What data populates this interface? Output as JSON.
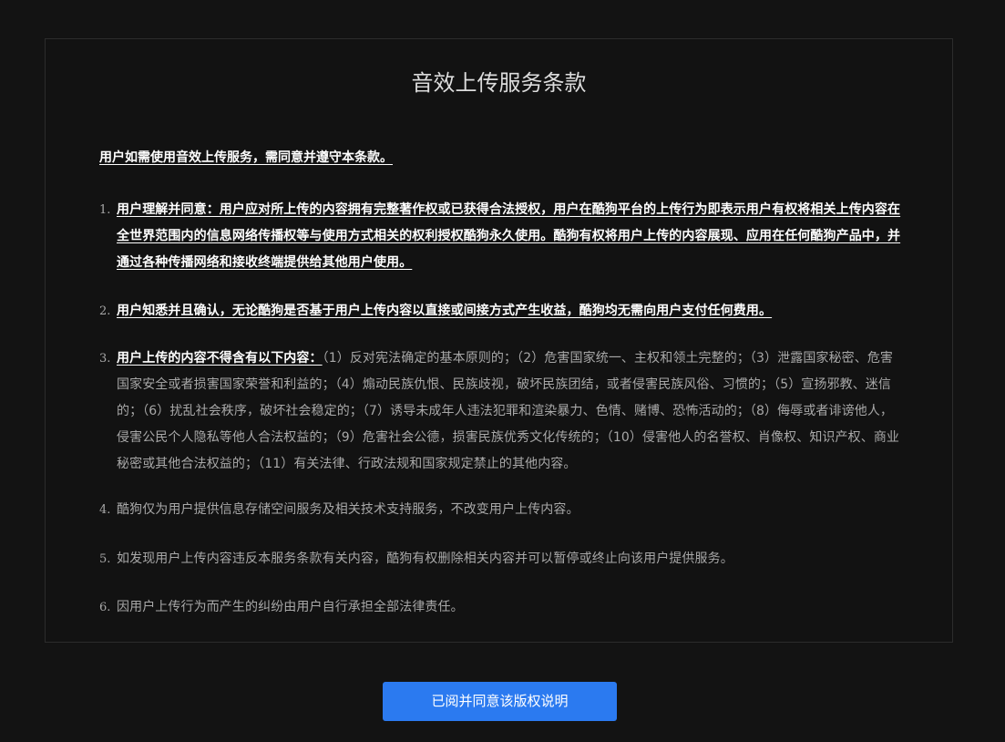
{
  "terms": {
    "title": "音效上传服务条款",
    "intro": "用户如需使用音效上传服务，需同意并遵守本条款。",
    "clauses": [
      {
        "number": "1.",
        "emphasis": "用户理解并同意：用户应对所上传的内容拥有完整著作权或已获得合法授权，用户在酷狗平台的上传行为即表示用户有权将相关上传内容在全世界范围内的信息网络传播权等与使用方式相关的权利授权酷狗永久使用。酷狗有权将用户上传的内容展现、应用在任何酷狗产品中，并通过各种传播网络和接收终端提供给其他用户使用。",
        "text": ""
      },
      {
        "number": "2.",
        "emphasis": "用户知悉并且确认，无论酷狗是否基于用户上传内容以直接或间接方式产生收益，酷狗均无需向用户支付任何费用。",
        "text": ""
      },
      {
        "number": "3.",
        "emphasis": "用户上传的内容不得含有以下内容：",
        "text": "（1）反对宪法确定的基本原则的；（2）危害国家统一、主权和领土完整的；（3）泄露国家秘密、危害国家安全或者损害国家荣誉和利益的；（4）煽动民族仇恨、民族歧视，破坏民族团结，或者侵害民族风俗、习惯的；（5）宣扬邪教、迷信的；（6）扰乱社会秩序，破坏社会稳定的；（7）诱导未成年人违法犯罪和渲染暴力、色情、赌博、恐怖活动的；（8）侮辱或者诽谤他人，侵害公民个人隐私等他人合法权益的；（9）危害社会公德，损害民族优秀文化传统的；（10）侵害他人的名誉权、肖像权、知识产权、商业秘密或其他合法权益的；（11）有关法律、行政法规和国家规定禁止的其他内容。"
      },
      {
        "number": "4.",
        "emphasis": "",
        "text": "酷狗仅为用户提供信息存储空间服务及相关技术支持服务，不改变用户上传内容。"
      },
      {
        "number": "5.",
        "emphasis": "",
        "text": "如发现用户上传内容违反本服务条款有关内容，酷狗有权删除相关内容并可以暂停或终止向该用户提供服务。"
      },
      {
        "number": "6.",
        "emphasis": "",
        "text": "因用户上传行为而产生的纠纷由用户自行承担全部法律责任。"
      }
    ]
  },
  "actions": {
    "confirm_label": "已阅并同意该版权说明"
  },
  "colors": {
    "background": "#131313",
    "panel_border": "#2c2c2c",
    "emphasis_text": "#ffffff",
    "body_text": "#a8a8a8",
    "button": "#2b7af0"
  }
}
